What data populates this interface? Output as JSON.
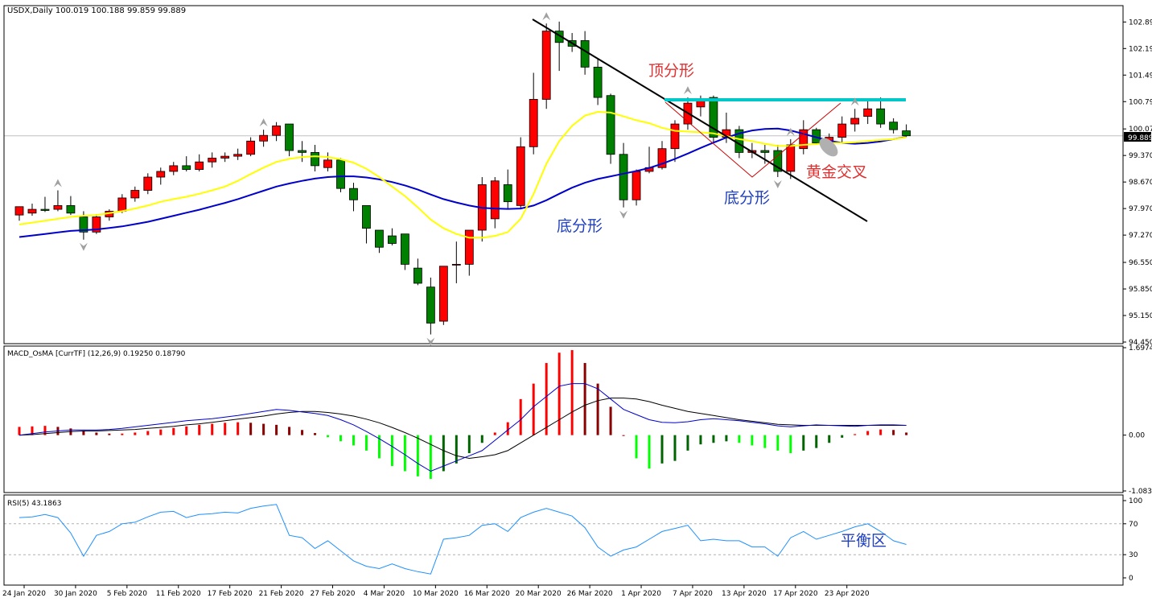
{
  "main_panel": {
    "header": "USDX,Daily  100.019 100.188 99.859 99.889",
    "current_price": "99.889",
    "price_labels": [
      "102.890",
      "102.190",
      "101.490",
      "100.790",
      "100.070",
      "99.370",
      "98.670",
      "97.970",
      "97.270",
      "96.550",
      "95.850",
      "95.150",
      "94.450"
    ],
    "annotations": {
      "top_fractal": "顶分形",
      "bottom_fractal_1": "底分形",
      "bottom_fractal_2": "底分形",
      "golden_cross": "黄金交叉"
    }
  },
  "macd_panel": {
    "header": "MACD_OsMA [CurrTF] (12,26,9) 0.19250 0.18790",
    "labels": [
      "1.69749",
      "0.00",
      "-1.08336"
    ]
  },
  "rsi_panel": {
    "header": "RSI(5) 43.1863",
    "labels": [
      "100",
      "70",
      "30",
      "0"
    ],
    "annotation": "平衡区"
  },
  "x_axis": {
    "labels": [
      "24 Jan 2020",
      "30 Jan 2020",
      "5 Feb 2020",
      "11 Feb 2020",
      "17 Feb 2020",
      "21 Feb 2020",
      "27 Feb 2020",
      "4 Mar 2020",
      "10 Mar 2020",
      "16 Mar 2020",
      "20 Mar 2020",
      "26 Mar 2020",
      "1 Apr 2020",
      "7 Apr 2020",
      "13 Apr 2020",
      "17 Apr 2020",
      "23 Apr 2020"
    ]
  },
  "colors": {
    "bull": "#ff0000",
    "bear": "#008000",
    "ema_fast": "#ffff00",
    "ema_slow": "#0000cc",
    "resistance": "#00c8c8",
    "hist_pos_strong": "#ff0000",
    "hist_pos_weak": "#8b0000",
    "hist_neg_strong": "#00ff00",
    "hist_neg_weak": "#006400",
    "rsi_line": "#1e90ff"
  },
  "chart_data": [
    {
      "type": "candlestick",
      "title": "USDX,Daily",
      "ylim": [
        94.45,
        103.3
      ],
      "candles": [
        {
          "o": 97.8,
          "h": 97.98,
          "l": 97.65,
          "c": 98.02
        },
        {
          "o": 97.85,
          "h": 98.1,
          "l": 97.78,
          "c": 97.95
        },
        {
          "o": 97.95,
          "h": 98.28,
          "l": 97.88,
          "c": 97.92
        },
        {
          "o": 97.95,
          "h": 98.45,
          "l": 97.9,
          "c": 98.05
        },
        {
          "o": 98.05,
          "h": 98.3,
          "l": 97.8,
          "c": 97.85
        },
        {
          "o": 97.75,
          "h": 97.9,
          "l": 97.15,
          "c": 97.35
        },
        {
          "o": 97.35,
          "h": 97.82,
          "l": 97.3,
          "c": 97.75
        },
        {
          "o": 97.75,
          "h": 97.95,
          "l": 97.65,
          "c": 97.9
        },
        {
          "o": 97.9,
          "h": 98.35,
          "l": 97.85,
          "c": 98.25
        },
        {
          "o": 98.25,
          "h": 98.55,
          "l": 98.15,
          "c": 98.45
        },
        {
          "o": 98.45,
          "h": 98.9,
          "l": 98.35,
          "c": 98.8
        },
        {
          "o": 98.8,
          "h": 99.05,
          "l": 98.6,
          "c": 98.95
        },
        {
          "o": 98.95,
          "h": 99.2,
          "l": 98.85,
          "c": 99.1
        },
        {
          "o": 99.1,
          "h": 99.35,
          "l": 98.95,
          "c": 99.0
        },
        {
          "o": 99.0,
          "h": 99.4,
          "l": 98.95,
          "c": 99.2
        },
        {
          "o": 99.2,
          "h": 99.45,
          "l": 99.05,
          "c": 99.3
        },
        {
          "o": 99.3,
          "h": 99.45,
          "l": 99.2,
          "c": 99.35
        },
        {
          "o": 99.35,
          "h": 99.55,
          "l": 99.25,
          "c": 99.4
        },
        {
          "o": 99.4,
          "h": 99.85,
          "l": 99.35,
          "c": 99.75
        },
        {
          "o": 99.75,
          "h": 100.05,
          "l": 99.6,
          "c": 99.9
        },
        {
          "o": 99.9,
          "h": 100.25,
          "l": 99.75,
          "c": 100.15
        },
        {
          "o": 100.2,
          "h": 100.2,
          "l": 99.35,
          "c": 99.5
        },
        {
          "o": 99.5,
          "h": 99.75,
          "l": 99.2,
          "c": 99.45
        },
        {
          "o": 99.45,
          "h": 99.65,
          "l": 98.95,
          "c": 99.1
        },
        {
          "o": 99.05,
          "h": 99.45,
          "l": 98.95,
          "c": 99.25
        },
        {
          "o": 99.25,
          "h": 99.3,
          "l": 98.4,
          "c": 98.5
        },
        {
          "o": 98.5,
          "h": 98.65,
          "l": 97.9,
          "c": 98.2
        },
        {
          "o": 98.05,
          "h": 98.05,
          "l": 97.05,
          "c": 97.45
        },
        {
          "o": 97.4,
          "h": 97.4,
          "l": 96.8,
          "c": 96.95
        },
        {
          "o": 97.25,
          "h": 97.45,
          "l": 97.0,
          "c": 97.05
        },
        {
          "o": 97.3,
          "h": 97.3,
          "l": 96.35,
          "c": 96.5
        },
        {
          "o": 96.4,
          "h": 96.65,
          "l": 95.95,
          "c": 96.0
        },
        {
          "o": 95.9,
          "h": 96.15,
          "l": 94.65,
          "c": 94.95
        },
        {
          "o": 95.0,
          "h": 96.45,
          "l": 94.9,
          "c": 96.45
        },
        {
          "o": 96.5,
          "h": 97.1,
          "l": 96.0,
          "c": 96.5
        },
        {
          "o": 96.5,
          "h": 97.4,
          "l": 96.2,
          "c": 97.4
        },
        {
          "o": 97.4,
          "h": 98.8,
          "l": 97.1,
          "c": 98.6
        },
        {
          "o": 97.7,
          "h": 98.8,
          "l": 97.45,
          "c": 98.7
        },
        {
          "o": 98.6,
          "h": 99.0,
          "l": 97.95,
          "c": 98.15
        },
        {
          "o": 98.05,
          "h": 99.85,
          "l": 97.95,
          "c": 99.6
        },
        {
          "o": 99.6,
          "h": 101.55,
          "l": 99.4,
          "c": 100.85
        },
        {
          "o": 100.85,
          "h": 102.85,
          "l": 100.6,
          "c": 102.65
        },
        {
          "o": 102.65,
          "h": 102.9,
          "l": 101.6,
          "c": 102.35
        },
        {
          "o": 102.4,
          "h": 102.6,
          "l": 102.1,
          "c": 102.25
        },
        {
          "o": 102.4,
          "h": 102.65,
          "l": 101.5,
          "c": 101.7
        },
        {
          "o": 101.7,
          "h": 101.9,
          "l": 100.7,
          "c": 100.9
        },
        {
          "o": 100.95,
          "h": 101.0,
          "l": 99.15,
          "c": 99.4
        },
        {
          "o": 99.4,
          "h": 99.7,
          "l": 98.0,
          "c": 98.2
        },
        {
          "o": 98.2,
          "h": 99.0,
          "l": 98.05,
          "c": 98.95
        },
        {
          "o": 98.95,
          "h": 99.6,
          "l": 98.9,
          "c": 99.05
        },
        {
          "o": 99.05,
          "h": 99.75,
          "l": 99.0,
          "c": 99.55
        },
        {
          "o": 99.55,
          "h": 100.3,
          "l": 99.2,
          "c": 100.2
        },
        {
          "o": 100.2,
          "h": 100.9,
          "l": 100.05,
          "c": 100.75
        },
        {
          "o": 100.65,
          "h": 100.95,
          "l": 100.4,
          "c": 100.85
        },
        {
          "o": 100.9,
          "h": 100.95,
          "l": 99.7,
          "c": 99.85
        },
        {
          "o": 99.85,
          "h": 100.5,
          "l": 99.7,
          "c": 100.05
        },
        {
          "o": 100.05,
          "h": 100.15,
          "l": 99.3,
          "c": 99.45
        },
        {
          "o": 99.45,
          "h": 99.7,
          "l": 99.3,
          "c": 99.5
        },
        {
          "o": 99.5,
          "h": 99.65,
          "l": 99.15,
          "c": 99.45
        },
        {
          "o": 99.5,
          "h": 99.65,
          "l": 98.8,
          "c": 98.95
        },
        {
          "o": 98.95,
          "h": 99.8,
          "l": 98.75,
          "c": 99.65
        },
        {
          "o": 99.55,
          "h": 100.3,
          "l": 99.4,
          "c": 100.05
        },
        {
          "o": 100.05,
          "h": 100.1,
          "l": 99.65,
          "c": 99.7
        },
        {
          "o": 99.7,
          "h": 99.95,
          "l": 99.55,
          "c": 99.85
        },
        {
          "o": 99.85,
          "h": 100.4,
          "l": 99.7,
          "c": 100.2
        },
        {
          "o": 100.2,
          "h": 100.6,
          "l": 100.0,
          "c": 100.35
        },
        {
          "o": 100.4,
          "h": 100.85,
          "l": 100.2,
          "c": 100.6
        },
        {
          "o": 100.6,
          "h": 100.9,
          "l": 100.1,
          "c": 100.2
        },
        {
          "o": 100.25,
          "h": 100.35,
          "l": 99.95,
          "c": 100.05
        },
        {
          "o": 100.02,
          "h": 100.19,
          "l": 99.86,
          "c": 99.89
        }
      ],
      "ema_fast": [
        97.55,
        97.6,
        97.65,
        97.7,
        97.75,
        97.78,
        97.8,
        97.85,
        97.9,
        97.97,
        98.05,
        98.15,
        98.22,
        98.28,
        98.36,
        98.45,
        98.55,
        98.7,
        98.88,
        99.05,
        99.2,
        99.28,
        99.33,
        99.35,
        99.33,
        99.27,
        99.18,
        99.02,
        98.8,
        98.55,
        98.3,
        98.0,
        97.68,
        97.45,
        97.3,
        97.2,
        97.2,
        97.25,
        97.35,
        97.7,
        98.35,
        99.15,
        99.75,
        100.15,
        100.42,
        100.52,
        100.5,
        100.4,
        100.3,
        100.22,
        100.1,
        100.02,
        100.0,
        99.98,
        99.95,
        99.88,
        99.8,
        99.75,
        99.68,
        99.62,
        99.62,
        99.65,
        99.67,
        99.7,
        99.7,
        99.72,
        99.75,
        99.78,
        99.8,
        99.85
      ],
      "ema_slow": [
        97.22,
        97.26,
        97.3,
        97.34,
        97.38,
        97.4,
        97.42,
        97.46,
        97.5,
        97.56,
        97.62,
        97.7,
        97.78,
        97.86,
        97.94,
        98.03,
        98.12,
        98.22,
        98.33,
        98.44,
        98.55,
        98.63,
        98.7,
        98.76,
        98.8,
        98.82,
        98.82,
        98.79,
        98.74,
        98.67,
        98.58,
        98.47,
        98.34,
        98.22,
        98.13,
        98.05,
        97.99,
        97.97,
        97.96,
        97.97,
        98.05,
        98.19,
        98.36,
        98.52,
        98.65,
        98.75,
        98.82,
        98.89,
        98.96,
        99.04,
        99.15,
        99.28,
        99.42,
        99.57,
        99.71,
        99.84,
        99.95,
        100.03,
        100.07,
        100.08,
        100.03,
        99.94,
        99.85,
        99.76,
        99.7,
        99.68,
        99.7,
        99.74,
        99.8,
        99.86
      ]
    },
    {
      "type": "bar",
      "title": "MACD_OsMA [CurrTF] (12,26,9)",
      "ylim": [
        -1.08336,
        1.69749
      ],
      "histogram": [
        0.16,
        0.17,
        0.18,
        0.16,
        0.13,
        0.09,
        0.05,
        0.03,
        0.03,
        0.05,
        0.08,
        0.11,
        0.14,
        0.17,
        0.2,
        0.22,
        0.24,
        0.25,
        0.24,
        0.22,
        0.2,
        0.16,
        0.1,
        0.04,
        -0.04,
        -0.12,
        -0.2,
        -0.3,
        -0.45,
        -0.6,
        -0.7,
        -0.8,
        -0.85,
        -0.7,
        -0.55,
        -0.35,
        -0.15,
        0.05,
        0.25,
        0.7,
        1.0,
        1.4,
        1.6,
        1.65,
        1.4,
        1.0,
        0.55,
        0.0,
        -0.45,
        -0.65,
        -0.55,
        -0.5,
        -0.3,
        -0.18,
        -0.15,
        -0.12,
        -0.15,
        -0.2,
        -0.25,
        -0.3,
        -0.35,
        -0.3,
        -0.25,
        -0.15,
        -0.05,
        0.02,
        0.08,
        0.11,
        0.1,
        0.05
      ],
      "macd_line": [
        0.0,
        0.03,
        0.06,
        0.08,
        0.1,
        0.1,
        0.1,
        0.11,
        0.13,
        0.16,
        0.19,
        0.22,
        0.25,
        0.28,
        0.3,
        0.32,
        0.35,
        0.38,
        0.42,
        0.46,
        0.5,
        0.48,
        0.45,
        0.42,
        0.38,
        0.3,
        0.2,
        0.07,
        -0.07,
        -0.22,
        -0.38,
        -0.55,
        -0.7,
        -0.6,
        -0.5,
        -0.4,
        -0.3,
        -0.1,
        0.1,
        0.3,
        0.55,
        0.75,
        0.95,
        1.0,
        1.0,
        0.9,
        0.7,
        0.5,
        0.4,
        0.3,
        0.25,
        0.24,
        0.26,
        0.3,
        0.32,
        0.3,
        0.28,
        0.25,
        0.22,
        0.18,
        0.16,
        0.18,
        0.2,
        0.19,
        0.18,
        0.17,
        0.19,
        0.2,
        0.2,
        0.19
      ],
      "signal_line": [
        0.0,
        0.01,
        0.03,
        0.05,
        0.07,
        0.08,
        0.08,
        0.09,
        0.1,
        0.11,
        0.13,
        0.15,
        0.17,
        0.2,
        0.22,
        0.25,
        0.28,
        0.31,
        0.34,
        0.37,
        0.41,
        0.44,
        0.46,
        0.46,
        0.44,
        0.41,
        0.37,
        0.31,
        0.24,
        0.15,
        0.05,
        -0.06,
        -0.18,
        -0.3,
        -0.4,
        -0.45,
        -0.42,
        -0.38,
        -0.3,
        -0.15,
        0.0,
        0.15,
        0.3,
        0.45,
        0.58,
        0.67,
        0.72,
        0.72,
        0.7,
        0.65,
        0.58,
        0.52,
        0.46,
        0.42,
        0.38,
        0.34,
        0.3,
        0.27,
        0.24,
        0.21,
        0.2,
        0.19,
        0.19,
        0.19,
        0.19,
        0.19,
        0.19,
        0.19,
        0.19,
        0.19
      ]
    },
    {
      "type": "line",
      "title": "RSI(5)",
      "ylim": [
        0,
        100
      ],
      "values": [
        78,
        79,
        82,
        78,
        58,
        28,
        55,
        60,
        70,
        72,
        79,
        85,
        86,
        78,
        82,
        83,
        85,
        84,
        90,
        93,
        95,
        55,
        52,
        38,
        48,
        35,
        22,
        15,
        12,
        18,
        12,
        8,
        5,
        50,
        52,
        55,
        68,
        70,
        60,
        78,
        85,
        90,
        85,
        80,
        65,
        40,
        28,
        36,
        40,
        50,
        60,
        64,
        68,
        48,
        50,
        48,
        48,
        40,
        40,
        28,
        52,
        60,
        50,
        55,
        60,
        66,
        70,
        60,
        48,
        43.19
      ]
    }
  ]
}
